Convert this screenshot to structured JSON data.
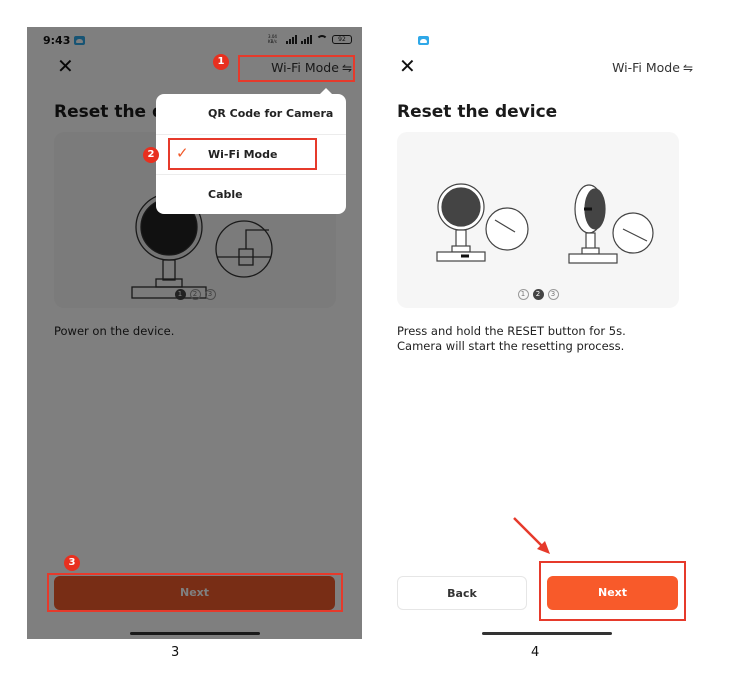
{
  "left_screen": {
    "status_bar": {
      "time": "9:43",
      "network_speed": "3.04 KB/s",
      "battery": "92"
    },
    "header": {
      "close_icon": "close-icon",
      "mode_label": "Wi-Fi Mode",
      "mode_icon": "swap-arrows-icon"
    },
    "title": "Reset the device",
    "carousel": {
      "pages": [
        "1",
        "2",
        "3"
      ],
      "active_page": 1
    },
    "instruction": "Power on the device.",
    "dropdown": {
      "items": [
        {
          "label": "QR Code for Camera",
          "selected": false
        },
        {
          "label": "Wi-Fi Mode",
          "selected": true
        },
        {
          "label": "Cable",
          "selected": false
        }
      ]
    },
    "next_button": {
      "label": "Next"
    },
    "annotations": [
      "1",
      "2",
      "3"
    ],
    "caption": "3"
  },
  "right_screen": {
    "header": {
      "close_icon": "close-icon",
      "mode_label": "Wi-Fi Mode",
      "mode_icon": "swap-arrows-icon"
    },
    "title": "Reset the device",
    "carousel": {
      "pages": [
        "1",
        "2",
        "3"
      ],
      "active_page": 2
    },
    "instruction_line1": "Press and hold the RESET button for 5s.",
    "instruction_line2": "Camera will start the resetting process.",
    "back_button": {
      "label": "Back"
    },
    "next_button": {
      "label": "Next"
    },
    "caption": "4"
  },
  "colors": {
    "accent": "#f15a2b",
    "annotation_red": "#e63a2b",
    "overlay_gray": "#7f7f7f"
  }
}
